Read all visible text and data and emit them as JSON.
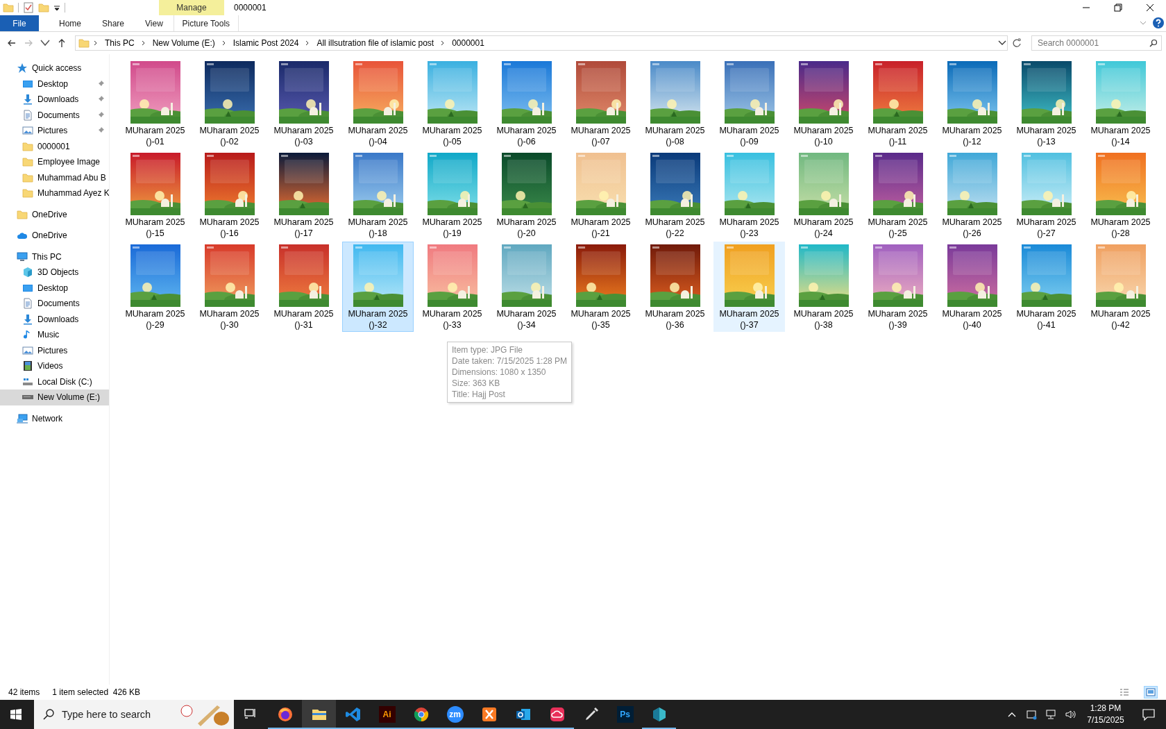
{
  "window": {
    "title": "0000001"
  },
  "ribbon": {
    "context_group": "Manage",
    "tabs": [
      {
        "label": "File",
        "kind": "file"
      },
      {
        "label": "Home",
        "kind": "normal"
      },
      {
        "label": "Share",
        "kind": "normal"
      },
      {
        "label": "View",
        "kind": "normal"
      },
      {
        "label": "Picture Tools",
        "kind": "contextual"
      }
    ]
  },
  "address_bar": {
    "crumbs": [
      "This PC",
      "New Volume (E:)",
      "Islamic Post 2024",
      "All illsutration file of islamic post",
      "0000001"
    ]
  },
  "search": {
    "placeholder": "Search 0000001"
  },
  "nav": [
    {
      "label": "Quick access",
      "kind": "star",
      "selected": false,
      "children": [
        {
          "label": "Desktop",
          "kind": "desktop",
          "pinned": true,
          "selected": false
        },
        {
          "label": "Downloads",
          "kind": "downloads",
          "pinned": true,
          "selected": false
        },
        {
          "label": "Documents",
          "kind": "documents",
          "pinned": true,
          "selected": false
        },
        {
          "label": "Pictures",
          "kind": "pictures",
          "pinned": true,
          "selected": false
        },
        {
          "label": "0000001",
          "kind": "folder",
          "pinned": false,
          "selected": false
        },
        {
          "label": "Employee Image",
          "kind": "folder",
          "pinned": false,
          "selected": false
        },
        {
          "label": "Muhammad Abu B",
          "kind": "folder",
          "pinned": false,
          "selected": false
        },
        {
          "label": "Muhammad Ayez K",
          "kind": "folder",
          "pinned": false,
          "selected": false
        }
      ]
    },
    {
      "label": "OneDrive",
      "kind": "folder",
      "selected": false
    },
    {
      "label": "OneDrive",
      "kind": "cloud",
      "selected": false
    },
    {
      "label": "This PC",
      "kind": "pc",
      "selected": false,
      "children": [
        {
          "label": "3D Objects",
          "kind": "cube",
          "pinned": false,
          "selected": false
        },
        {
          "label": "Desktop",
          "kind": "desktop",
          "pinned": false,
          "selected": false
        },
        {
          "label": "Documents",
          "kind": "documents",
          "pinned": false,
          "selected": false
        },
        {
          "label": "Downloads",
          "kind": "downloads",
          "pinned": false,
          "selected": false
        },
        {
          "label": "Music",
          "kind": "music",
          "pinned": false,
          "selected": false
        },
        {
          "label": "Pictures",
          "kind": "pictures",
          "pinned": false,
          "selected": false
        },
        {
          "label": "Videos",
          "kind": "videos",
          "pinned": false,
          "selected": false
        },
        {
          "label": "Local Disk (C:)",
          "kind": "disk",
          "pinned": false,
          "selected": false
        },
        {
          "label": "New Volume (E:)",
          "kind": "drive",
          "pinned": false,
          "selected": true
        }
      ]
    },
    {
      "label": "Network",
      "kind": "network",
      "selected": false
    }
  ],
  "files": [
    {
      "label": "MUharam 2025 ()-01",
      "selected": false,
      "hot": false
    },
    {
      "label": "MUharam 2025 ()-02",
      "selected": false,
      "hot": false
    },
    {
      "label": "MUharam 2025 ()-03",
      "selected": false,
      "hot": false
    },
    {
      "label": "MUharam 2025 ()-04",
      "selected": false,
      "hot": false
    },
    {
      "label": "MUharam 2025 ()-05",
      "selected": false,
      "hot": false
    },
    {
      "label": "MUharam 2025 ()-06",
      "selected": false,
      "hot": false
    },
    {
      "label": "MUharam 2025 ()-07",
      "selected": false,
      "hot": false
    },
    {
      "label": "MUharam 2025 ()-08",
      "selected": false,
      "hot": false
    },
    {
      "label": "MUharam 2025 ()-09",
      "selected": false,
      "hot": false
    },
    {
      "label": "MUharam 2025 ()-10",
      "selected": false,
      "hot": false
    },
    {
      "label": "MUharam 2025 ()-11",
      "selected": false,
      "hot": false
    },
    {
      "label": "MUharam 2025 ()-12",
      "selected": false,
      "hot": false
    },
    {
      "label": "MUharam 2025 ()-13",
      "selected": false,
      "hot": false
    },
    {
      "label": "MUharam 2025 ()-14",
      "selected": false,
      "hot": false
    },
    {
      "label": "MUharam 2025 ()-15",
      "selected": false,
      "hot": false
    },
    {
      "label": "MUharam 2025 ()-16",
      "selected": false,
      "hot": false
    },
    {
      "label": "MUharam 2025 ()-17",
      "selected": false,
      "hot": false
    },
    {
      "label": "MUharam 2025 ()-18",
      "selected": false,
      "hot": false
    },
    {
      "label": "MUharam 2025 ()-19",
      "selected": false,
      "hot": false
    },
    {
      "label": "MUharam 2025 ()-20",
      "selected": false,
      "hot": false
    },
    {
      "label": "MUharam 2025 ()-21",
      "selected": false,
      "hot": false
    },
    {
      "label": "MUharam 2025 ()-22",
      "selected": false,
      "hot": false
    },
    {
      "label": "MUharam 2025 ()-23",
      "selected": false,
      "hot": false
    },
    {
      "label": "MUharam 2025 ()-24",
      "selected": false,
      "hot": false
    },
    {
      "label": "MUharam 2025 ()-25",
      "selected": false,
      "hot": false
    },
    {
      "label": "MUharam 2025 ()-26",
      "selected": false,
      "hot": false
    },
    {
      "label": "MUharam 2025 ()-27",
      "selected": false,
      "hot": false
    },
    {
      "label": "MUharam 2025 ()-28",
      "selected": false,
      "hot": false
    },
    {
      "label": "MUharam 2025 ()-29",
      "selected": false,
      "hot": false
    },
    {
      "label": "MUharam 2025 ()-30",
      "selected": false,
      "hot": false
    },
    {
      "label": "MUharam 2025 ()-31",
      "selected": false,
      "hot": false
    },
    {
      "label": "MUharam 2025 ()-32",
      "selected": true,
      "hot": false
    },
    {
      "label": "MUharam 2025 ()-33",
      "selected": false,
      "hot": false
    },
    {
      "label": "MUharam 2025 ()-34",
      "selected": false,
      "hot": false
    },
    {
      "label": "MUharam 2025 ()-35",
      "selected": false,
      "hot": false
    },
    {
      "label": "MUharam 2025 ()-36",
      "selected": false,
      "hot": false
    },
    {
      "label": "MUharam 2025 ()-37",
      "selected": false,
      "hot": true
    },
    {
      "label": "MUharam 2025 ()-38",
      "selected": false,
      "hot": false
    },
    {
      "label": "MUharam 2025 ()-39",
      "selected": false,
      "hot": false
    },
    {
      "label": "MUharam 2025 ()-40",
      "selected": false,
      "hot": false
    },
    {
      "label": "MUharam 2025 ()-41",
      "selected": false,
      "hot": false
    },
    {
      "label": "MUharam 2025 ()-42",
      "selected": false,
      "hot": false
    }
  ],
  "tooltip": {
    "lines": [
      "Item type: JPG File",
      "Date taken: 7/15/2025 1:28 PM",
      "Dimensions: 1080 x 1350",
      "Size: 363 KB",
      "Title: Hajj Post"
    ]
  },
  "status_bar": {
    "item_count": "42 items",
    "selection": "1 item selected  426 KB"
  },
  "view_buttons": [
    {
      "kind": "details",
      "selected": false
    },
    {
      "kind": "large-icons",
      "selected": true
    }
  ],
  "taskbar": {
    "search_placeholder": "Type here to search",
    "apps": [
      {
        "kind": "task-view",
        "running": false,
        "active": false
      },
      {
        "kind": "firefox",
        "running": true,
        "active": false
      },
      {
        "kind": "explorer",
        "running": true,
        "active": true
      },
      {
        "kind": "vscode",
        "running": true,
        "active": false
      },
      {
        "kind": "illustrator",
        "text": "Ai",
        "running": true,
        "active": false
      },
      {
        "kind": "chrome",
        "running": true,
        "active": false
      },
      {
        "kind": "zoom",
        "text": "zm",
        "running": true,
        "active": false
      },
      {
        "kind": "xampp",
        "running": true,
        "active": false
      },
      {
        "kind": "outlook",
        "running": true,
        "active": false
      },
      {
        "kind": "creative-cloud",
        "running": true,
        "active": false
      },
      {
        "kind": "pen",
        "running": false,
        "active": false
      },
      {
        "kind": "photoshop",
        "text": "Ps",
        "running": false,
        "active": false
      },
      {
        "kind": "diamond",
        "running": true,
        "active": false
      }
    ],
    "time": "1:28 PM",
    "date": "7/15/2025"
  }
}
